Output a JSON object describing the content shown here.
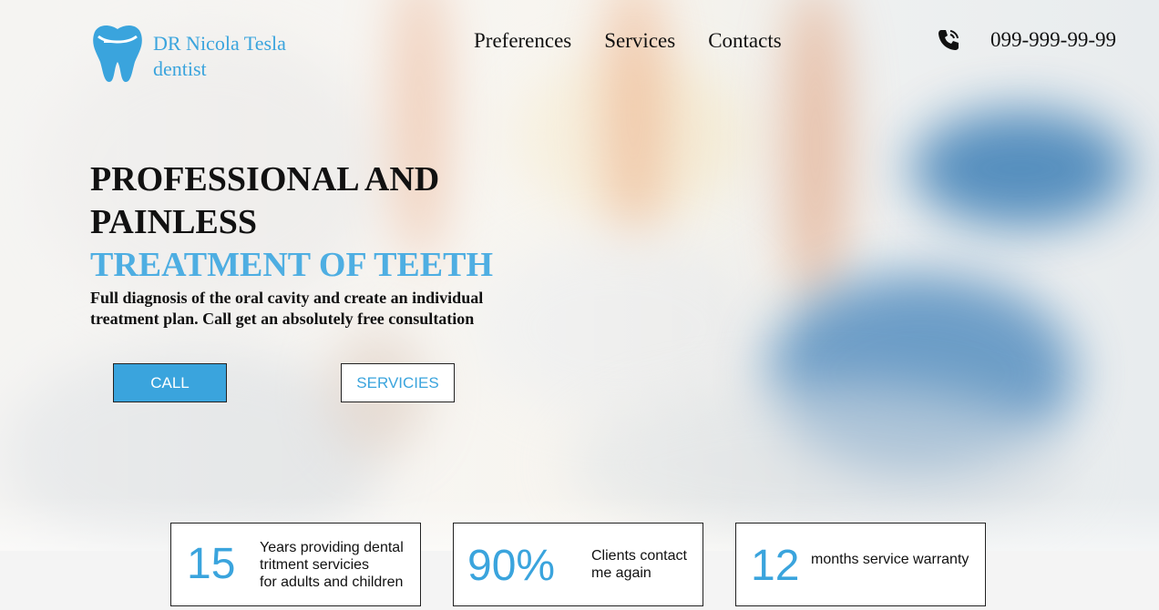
{
  "brand": {
    "name": "DR Nicola Tesla",
    "tagline": "dentist",
    "color": "#3aa4dd"
  },
  "nav": {
    "items": [
      {
        "label": "Preferences"
      },
      {
        "label": "Services"
      },
      {
        "label": "Contacts"
      }
    ]
  },
  "contact": {
    "icon": "phone-icon",
    "phone": "099-999-99-99"
  },
  "hero": {
    "headline_line1": "PROFESSIONAL AND",
    "headline_line2": "PAINLESS",
    "headline_accent": "TREATMENT OF TEETH",
    "subtext": "Full diagnosis of the oral cavity and create an individual treatment plan. Call get an absolutely free consultation"
  },
  "buttons": {
    "call_label": "CALL",
    "services_label": "SERVICIES"
  },
  "stats": [
    {
      "value": "15",
      "label_lines": [
        "Years providing dental",
        "tritment servicies",
        "for adults and children"
      ]
    },
    {
      "value": "90%",
      "label_lines": [
        "Clients contact",
        "me again"
      ]
    },
    {
      "value": "12",
      "label_lines": [
        "months service warranty"
      ]
    }
  ]
}
